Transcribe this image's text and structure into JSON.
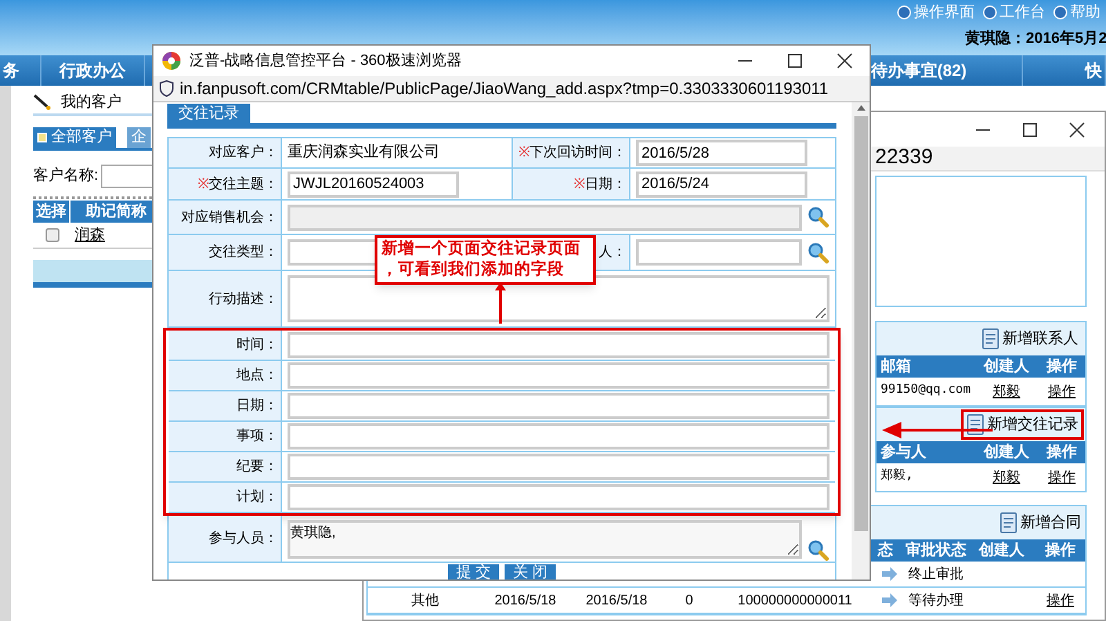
{
  "header": {
    "links": [
      "操作界面",
      "工作台",
      "帮助"
    ],
    "user_date": "黄琪隐：2016年5月2"
  },
  "nav_items": [
    "务",
    "行政办公",
    "待办事宜(82)",
    "快"
  ],
  "left_panel": {
    "title": "我的客户",
    "tabs": [
      {
        "label": "全部客户",
        "selected": true
      },
      {
        "label": "企",
        "selected": false
      }
    ],
    "search_label": "客户名称:",
    "columns": [
      "选择",
      "助记简称"
    ],
    "rows": [
      {
        "checked": false,
        "name": "润森"
      }
    ]
  },
  "back_window": {
    "address": "22339",
    "contacts": {
      "action": "新增联系人",
      "highlighted": false,
      "columns": [
        "邮箱",
        "创建人",
        "操作"
      ],
      "rows": [
        [
          "99150@qq.com",
          "郑毅",
          "操作"
        ]
      ]
    },
    "records": {
      "action": "新增交往记录",
      "highlighted": true,
      "columns": [
        "参与人",
        "创建人",
        "操作"
      ],
      "rows": [
        [
          "郑毅,",
          "郑毅",
          "操作"
        ]
      ]
    },
    "contracts": {
      "action": "新增合同",
      "columns": [
        "态",
        "审批状态",
        "创建人",
        "操作"
      ],
      "rows": [
        {
          "approval_status": "终止审批"
        },
        {
          "column_1": "其他",
          "column_2": "2016/5/18",
          "column_3": "2016/5/18",
          "column_4": "0",
          "column_5": "100000000000011",
          "approval_status": "等待办理",
          "action": "操作"
        }
      ]
    }
  },
  "popup": {
    "title": "泛普-战略信息管控平台 - 360极速浏览器",
    "address": "in.fanpusoft.com/CRMtable/PublicPage/JiaoWang_add.aspx?tmp=0.3303330601193011",
    "tab": "交往记录",
    "rows": [
      {
        "highlighted": false,
        "cells": [
          {
            "label": "对应客户：",
            "kind": "text",
            "value": "重庆润森实业有限公司"
          },
          {
            "mark": "※",
            "label": "下次回访时间：",
            "kind": "input",
            "value": "2016/5/28"
          }
        ]
      },
      {
        "highlighted": false,
        "cells": [
          {
            "mark": "※",
            "label": "交往主题：",
            "kind": "input",
            "value": "JWJL20160524003"
          },
          {
            "mark": "※",
            "label": "日期：",
            "kind": "input",
            "value": "2016/5/24"
          }
        ]
      },
      {
        "highlighted": false,
        "cells": [
          {
            "label": "对应销售机会：",
            "kind": "lookup",
            "disabled": true
          }
        ]
      },
      {
        "highlighted": false,
        "cells": [
          {
            "label": "交往类型：",
            "kind": "input"
          },
          {
            "label": "人：",
            "kind": "lookup",
            "disabled": false
          }
        ]
      },
      {
        "highlighted": false,
        "cells": [
          {
            "label": "行动描述：",
            "kind": "textarea"
          }
        ]
      },
      {
        "highlighted": true,
        "cells": [
          {
            "label": "时间：",
            "kind": "input"
          }
        ]
      },
      {
        "highlighted": true,
        "cells": [
          {
            "label": "地点：",
            "kind": "input"
          }
        ]
      },
      {
        "highlighted": true,
        "cells": [
          {
            "label": "日期：",
            "kind": "input"
          }
        ]
      },
      {
        "highlighted": true,
        "cells": [
          {
            "label": "事项：",
            "kind": "input"
          }
        ]
      },
      {
        "highlighted": true,
        "cells": [
          {
            "label": "纪要：",
            "kind": "input"
          }
        ]
      },
      {
        "highlighted": true,
        "cells": [
          {
            "label": "计划：",
            "kind": "input"
          }
        ]
      },
      {
        "highlighted": false,
        "cells": [
          {
            "label": "参与人员：",
            "kind": "textarea_lookup",
            "value": "黄琪隐,"
          }
        ]
      }
    ],
    "buttons": [
      "提 交",
      "关 闭"
    ]
  },
  "annotation": {
    "lines": [
      "新增一个页面交往记录页面",
      "，可看到我们添加的字段"
    ]
  }
}
